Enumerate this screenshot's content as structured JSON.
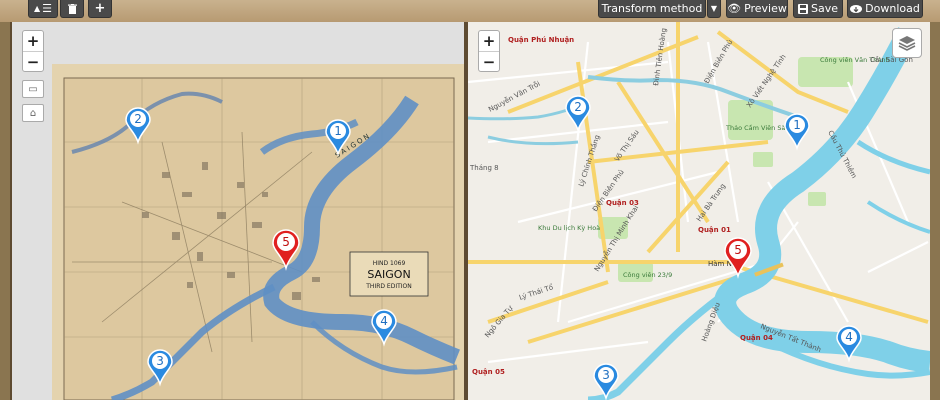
{
  "toolbar": {
    "menu_icon": "list-icon",
    "delete_icon": "trash-icon",
    "add_icon": "plus-icon",
    "transform_method_label": "Transform method",
    "preview_label": "Preview",
    "save_label": "Save",
    "download_label": "Download"
  },
  "left_map": {
    "zoom_in": "+",
    "zoom_out": "−",
    "map_code": "HIND 1069",
    "title": "SAIGON",
    "edition": "THIRD EDITION",
    "river_label": "S A I G O N"
  },
  "right_map": {
    "zoom_in": "+",
    "zoom_out": "−",
    "labels": [
      "Quận Phú Nhuận",
      "Đinh Tiên Hoàng",
      "Điện Biên Phủ",
      "Nguyễn Văn Trỗi",
      "Công viên Văn Thánh",
      "Xô Viết Nghệ Tĩnh",
      "Cầu Sài Gòn",
      "Thảo Cầm Viên Sài Gòn",
      "Cầu Thủ Thiêm",
      "Võ Thị Sáu",
      "Lý Chính Thắng",
      "Tháng 8",
      "Điện Biên Phủ",
      "Quận 03",
      "Hai Bà Trưng",
      "Quận 01",
      "Nguyễn Thị Minh Khai",
      "Khu Du lịch Kỳ Hoà",
      "Hàm Nghi",
      "Công viên 23/9",
      "Lý Thái Tổ",
      "Ngô Gia Tự",
      "Hoàng Diệu",
      "Nguyễn Tất Thành",
      "Quận 04",
      "Quận 05"
    ]
  },
  "markers": {
    "left": [
      "1",
      "2",
      "3",
      "4",
      "5"
    ],
    "right": [
      "1",
      "2",
      "3",
      "4",
      "5"
    ],
    "selected": "5"
  }
}
